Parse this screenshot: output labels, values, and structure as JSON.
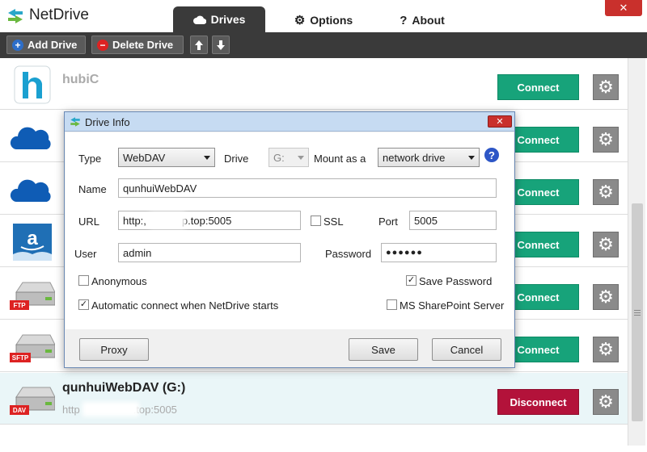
{
  "app": {
    "title": "NetDrive",
    "close_glyph": "✕",
    "tabs": [
      {
        "label": "Drives",
        "icon": "cloud-icon"
      },
      {
        "label": "Options",
        "icon": "gear-icon"
      },
      {
        "label": "About",
        "icon": "question-icon"
      }
    ]
  },
  "toolbar": {
    "add_label": "Add Drive",
    "delete_label": "Delete Drive",
    "up_glyph": "🡅",
    "down_glyph": "🡇"
  },
  "drives": [
    {
      "name": "hubiC",
      "url": "",
      "icon": "hubic-icon",
      "button": "Connect"
    },
    {
      "name": "",
      "url": "",
      "icon": "onedrive-icon",
      "button": "Connect"
    },
    {
      "name": "",
      "url": "",
      "icon": "onedrive-icon",
      "button": "Connect"
    },
    {
      "name": "",
      "url": "",
      "icon": "amazon-icon",
      "button": "Connect"
    },
    {
      "name": "",
      "url": "",
      "icon": "ftp-drive-icon",
      "badge": "FTP",
      "button": "Connect"
    },
    {
      "name": "",
      "url": "",
      "icon": "sftp-drive-icon",
      "badge": "SFTP",
      "button": "Connect"
    },
    {
      "name": "qunhuiWebDAV (G:)",
      "url_prefix": "http",
      "url_suffix": ".top:5005",
      "icon": "dav-drive-icon",
      "badge": "DAV",
      "button": "Disconnect"
    }
  ],
  "dialog": {
    "title": "Drive Info",
    "close_glyph": "✕",
    "type_label": "Type",
    "type_value": "WebDAV",
    "drive_label": "Drive",
    "drive_value": "G:",
    "mount_label": "Mount as a",
    "mount_value": "network drive",
    "name_label": "Name",
    "name_value": "qunhuiWebDAV",
    "url_label": "URL",
    "url_prefix": "http:,",
    "url_suffix": "p.top:5005",
    "ssl_label": "SSL",
    "ssl_checked": false,
    "port_label": "Port",
    "port_value": "5005",
    "user_label": "User",
    "user_value": "admin",
    "password_label": "Password",
    "password_value": "●●●●●●",
    "anonymous_label": "Anonymous",
    "anonymous_checked": false,
    "save_password_label": "Save Password",
    "save_password_checked": true,
    "autoconnect_label": "Automatic connect when NetDrive starts",
    "autoconnect_checked": true,
    "sharepoint_label": "MS SharePoint Server",
    "sharepoint_checked": false,
    "proxy_label": "Proxy",
    "save_label": "Save",
    "cancel_label": "Cancel",
    "help_glyph": "?",
    "check_glyph": "✓"
  },
  "colors": {
    "connect": "#17a37a",
    "disconnect": "#b3123a",
    "toolbar": "#3a3a3a"
  }
}
